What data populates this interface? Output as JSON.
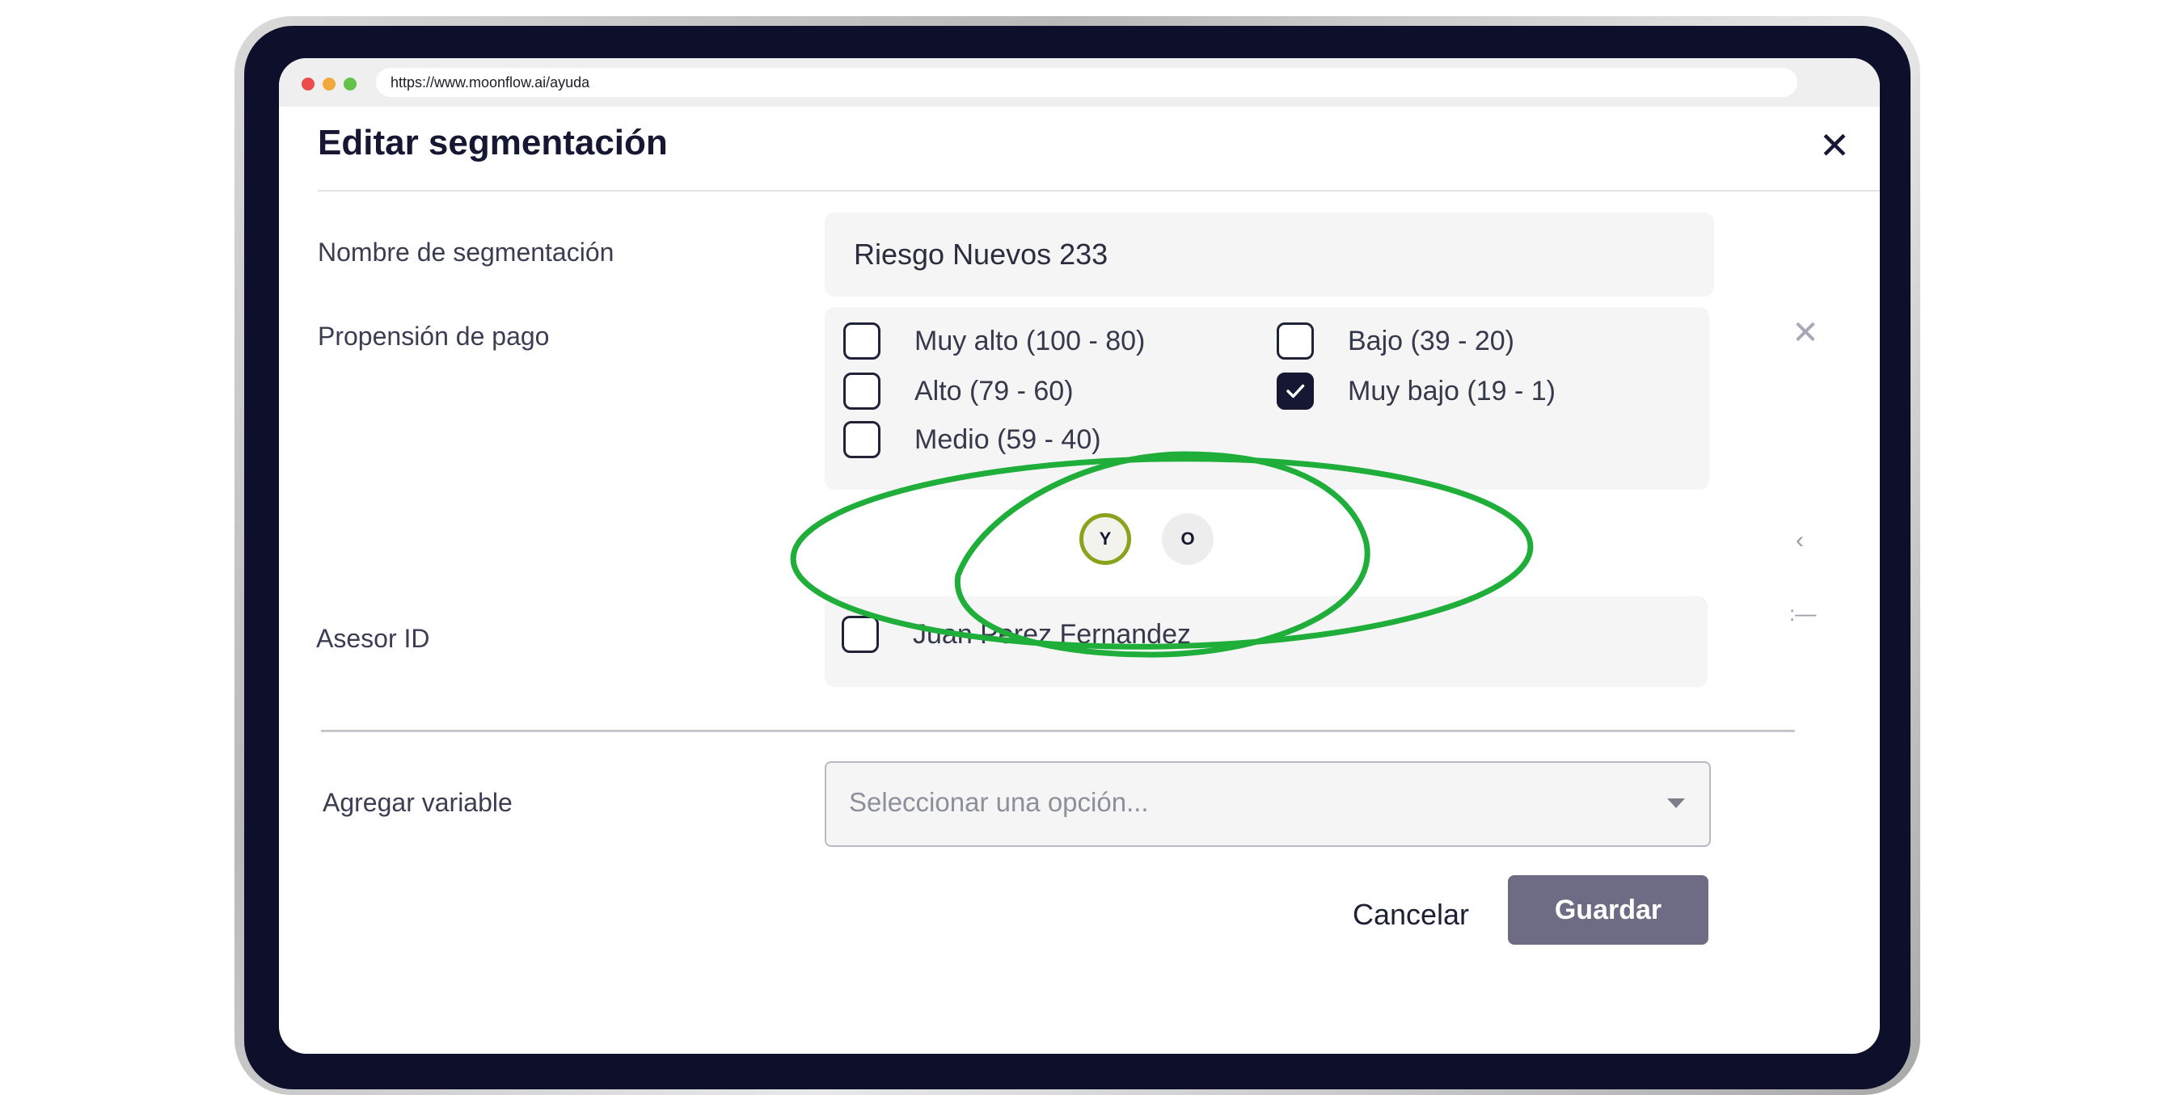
{
  "browser": {
    "url": "https://www.moonflow.ai/ayuda"
  },
  "modal": {
    "title": "Editar segmentación",
    "close_label": "✕",
    "segment_name": {
      "label": "Nombre de segmentación",
      "value": "Riesgo Nuevos 233"
    },
    "payment_propensity": {
      "label": "Propensión de pago",
      "remove_label": "✕",
      "options": [
        {
          "label": "Muy alto (100 - 80)",
          "checked": false
        },
        {
          "label": "Bajo (39 - 20)",
          "checked": false
        },
        {
          "label": "Alto (79 - 60)",
          "checked": false
        },
        {
          "label": "Muy bajo (19 - 1)",
          "checked": true
        },
        {
          "label": "Medio (59 - 40)",
          "checked": false
        }
      ]
    },
    "logic_operators": {
      "and_label": "Y",
      "or_label": "O"
    },
    "advisor": {
      "label": "Asesor ID",
      "options": [
        {
          "label": "Juan Perez Fernandez",
          "checked": false
        }
      ]
    },
    "add_variable": {
      "label": "Agregar variable",
      "placeholder": "Seleccionar una opción..."
    },
    "buttons": {
      "cancel": "Cancelar",
      "save": "Guardar"
    }
  },
  "colors": {
    "frame_bezel": "#0e0f2a",
    "primary_dark": "#151733",
    "save_button": "#6d6c84",
    "annotation_green": "#1fae3a",
    "selected_operator_ring": "#8aa31d"
  }
}
